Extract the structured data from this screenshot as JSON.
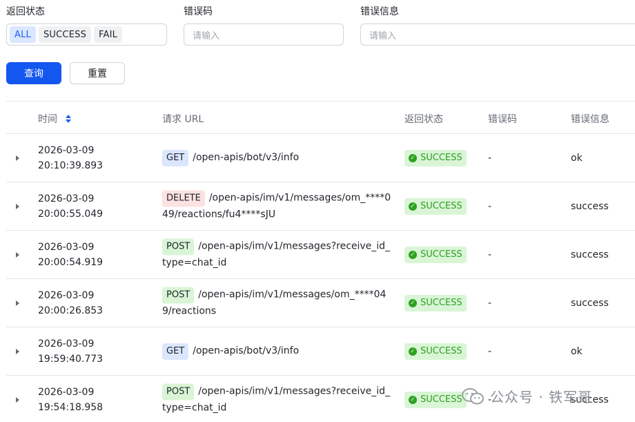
{
  "filters": {
    "status_label": "返回状态",
    "status_options": [
      "ALL",
      "SUCCESS",
      "FAIL"
    ],
    "status_selected": "ALL",
    "error_code_label": "错误码",
    "error_code_placeholder": "请输入",
    "error_msg_label": "错误信息",
    "error_msg_placeholder": "请输入"
  },
  "actions": {
    "query": "查询",
    "reset": "重置"
  },
  "table": {
    "columns": {
      "time": "时间",
      "url": "请求 URL",
      "status": "返回状态",
      "error_code": "错误码",
      "error_msg": "错误信息"
    },
    "rows": [
      {
        "date": "2026-03-09",
        "time": "20:10:39.893",
        "method": "GET",
        "url": "/open-apis/bot/v3/info",
        "status": "SUCCESS",
        "error_code": "-",
        "error_msg": "ok"
      },
      {
        "date": "2026-03-09",
        "time": "20:00:55.049",
        "method": "DELETE",
        "url": "/open-apis/im/v1/messages/om_****049/reactions/fu4****sJU",
        "status": "SUCCESS",
        "error_code": "-",
        "error_msg": "success"
      },
      {
        "date": "2026-03-09",
        "time": "20:00:54.919",
        "method": "POST",
        "url": "/open-apis/im/v1/messages?receive_id_type=chat_id",
        "status": "SUCCESS",
        "error_code": "-",
        "error_msg": "success"
      },
      {
        "date": "2026-03-09",
        "time": "20:00:26.853",
        "method": "POST",
        "url": "/open-apis/im/v1/messages/om_****049/reactions",
        "status": "SUCCESS",
        "error_code": "-",
        "error_msg": "success"
      },
      {
        "date": "2026-03-09",
        "time": "19:59:40.773",
        "method": "GET",
        "url": "/open-apis/bot/v3/info",
        "status": "SUCCESS",
        "error_code": "-",
        "error_msg": "ok"
      },
      {
        "date": "2026-03-09",
        "time": "19:54:18.958",
        "method": "POST",
        "url": "/open-apis/im/v1/messages?receive_id_type=chat_id",
        "status": "SUCCESS",
        "error_code": "-",
        "error_msg": "success"
      }
    ]
  },
  "watermark": {
    "text": "公众号 · 铁军哥",
    "icon": "wechat-icon"
  }
}
